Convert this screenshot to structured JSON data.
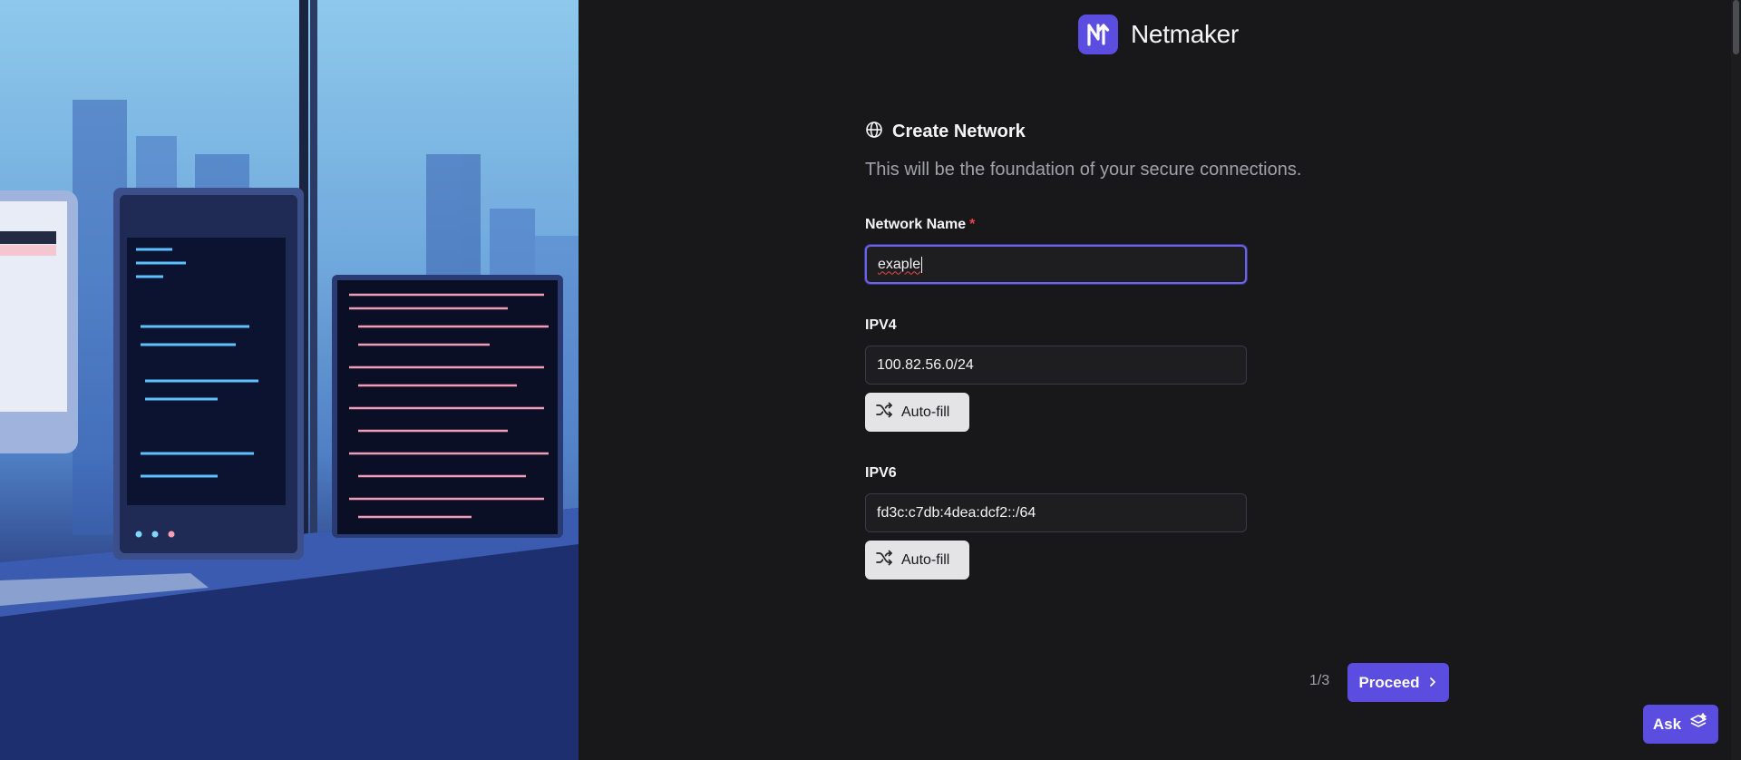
{
  "brand": {
    "name": "Netmaker",
    "logo_icon": "netmaker-n-logo-icon",
    "accent": "#5b4de0"
  },
  "form": {
    "title": "Create Network",
    "title_icon": "globe-icon",
    "subtitle": "This will be the foundation of your secure connections.",
    "network_name": {
      "label": "Network Name",
      "required_mark": "*",
      "value": "exaple"
    },
    "ipv4": {
      "label": "IPV4",
      "value": "100.82.56.0/24",
      "autofill_label": "Auto-fill"
    },
    "ipv6": {
      "label": "IPV6",
      "value": "fd3c:c7db:4dea:dcf2::/64",
      "autofill_label": "Auto-fill"
    }
  },
  "footer": {
    "step": "1/3",
    "proceed_label": "Proceed",
    "ask_label": "Ask"
  },
  "hero": {
    "description_icon": "workstation-illustration"
  }
}
